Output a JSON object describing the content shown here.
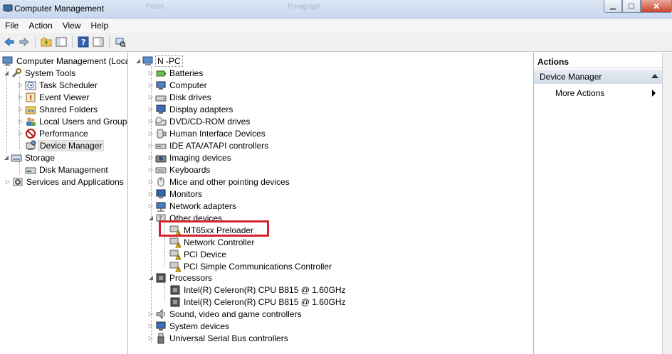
{
  "window": {
    "title": "Computer Management",
    "ghost_tabs": [
      "Posts",
      "Paragraph"
    ],
    "controls": {
      "minimize": "▁",
      "maximize": "▢",
      "close": "✕"
    }
  },
  "menu": [
    "File",
    "Action",
    "View",
    "Help"
  ],
  "toolbar": {
    "icons": [
      "back-arrow-icon",
      "forward-arrow-icon",
      "up-folder-icon",
      "show-hide-console-tree-icon",
      "help-icon",
      "show-hide-action-pane-icon",
      "scan-hardware-icon"
    ]
  },
  "left_tree": {
    "root": "Computer Management (Local",
    "system_tools": "System Tools",
    "task_scheduler": "Task Scheduler",
    "event_viewer": "Event Viewer",
    "shared_folders": "Shared Folders",
    "local_users": "Local Users and Groups",
    "performance": "Performance",
    "device_manager": "Device Manager",
    "storage": "Storage",
    "disk_management": "Disk Management",
    "services": "Services and Applications"
  },
  "device_tree": {
    "root": "N -PC",
    "categories": {
      "batteries": "Batteries",
      "computer": "Computer",
      "disk_drives": "Disk drives",
      "display_adapters": "Display adapters",
      "dvd": "DVD/CD-ROM drives",
      "hid": "Human Interface Devices",
      "ide": "IDE ATA/ATAPI controllers",
      "imaging": "Imaging devices",
      "keyboards": "Keyboards",
      "mice": "Mice and other pointing devices",
      "monitors": "Monitors",
      "network": "Network adapters",
      "other": "Other devices",
      "processors": "Processors",
      "sound": "Sound, video and game controllers",
      "system": "System devices",
      "usb": "Universal Serial Bus controllers"
    },
    "other_devices": {
      "mt65": "MT65xx Preloader",
      "netctrl": "Network Controller",
      "pci": "PCI Device",
      "pci_simple": "PCI Simple Communications Controller"
    },
    "processors": {
      "cpu1": "Intel(R) Celeron(R) CPU B815 @ 1.60GHz",
      "cpu2": "Intel(R) Celeron(R) CPU B815 @ 1.60GHz"
    }
  },
  "actions": {
    "header": "Actions",
    "section": "Device Manager",
    "more": "More Actions"
  },
  "colors": {
    "highlight": "#d4222e",
    "warning": "#f2c200"
  }
}
